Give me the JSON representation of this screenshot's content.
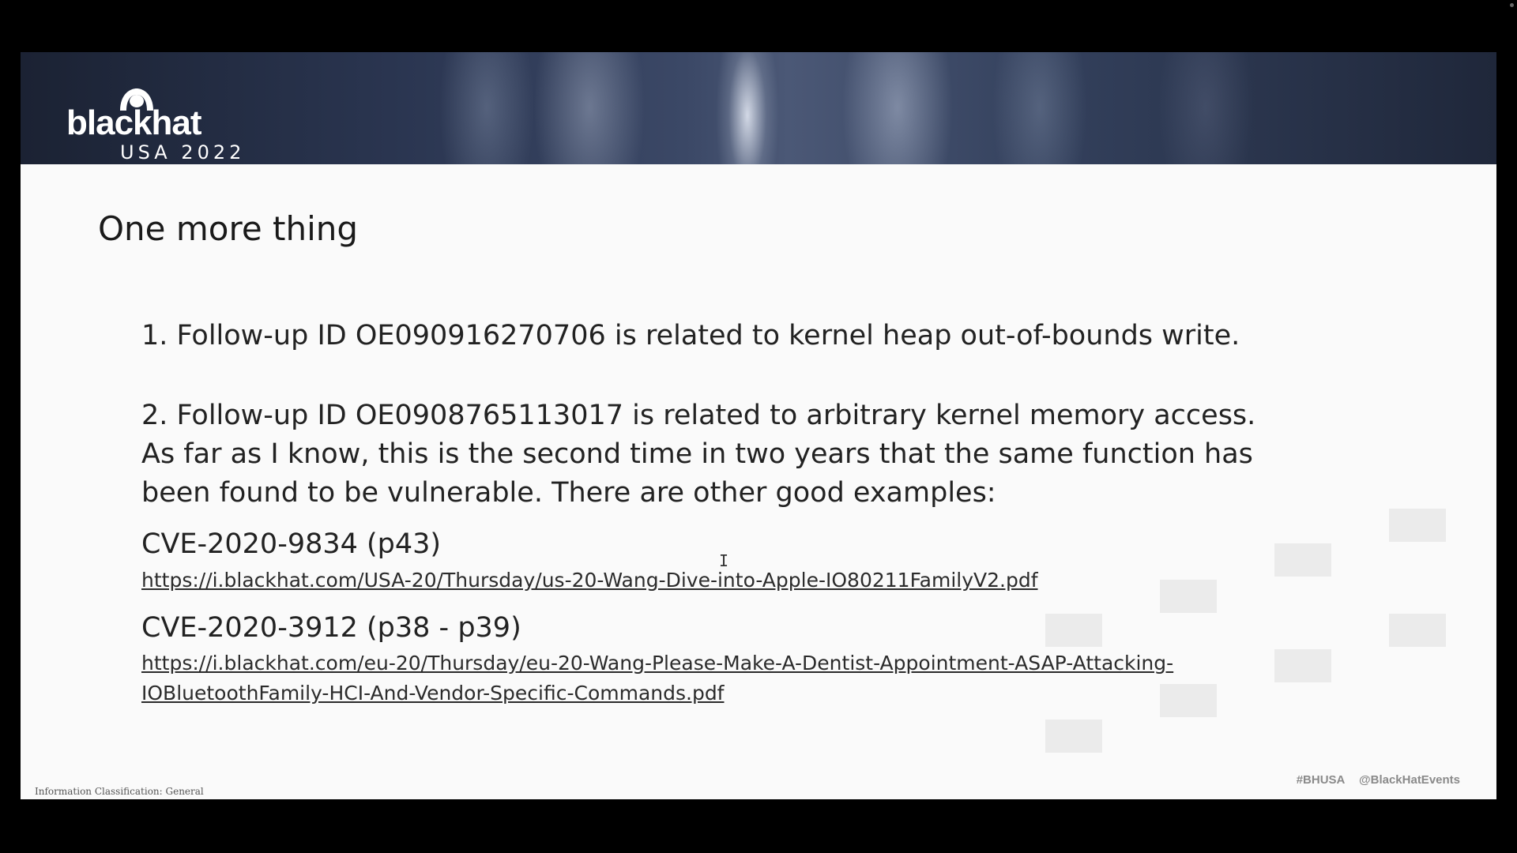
{
  "logo": {
    "brand": "blackhat",
    "sub": "USA 2022"
  },
  "slide": {
    "title": "One more thing",
    "item1": "1. Follow-up ID OE090916270706 is related to kernel heap out-of-bounds write.",
    "item2_lines": [
      "2. Follow-up ID OE0908765113017 is related to arbitrary kernel memory access.",
      "As far as I know, this is the second time in two years that the same function has",
      "been found to be vulnerable. There are other good examples:"
    ],
    "cves": [
      {
        "title": "CVE-2020-9834 (p43)",
        "link_lines": [
          "https://i.blackhat.com/USA-20/Thursday/us-20-Wang-Dive-into-Apple-IO80211FamilyV2.pdf"
        ]
      },
      {
        "title": "CVE-2020-3912 (p38 - p39)",
        "link_lines": [
          "https://i.blackhat.com/eu-20/Thursday/eu-20-Wang-Please-Make-A-Dentist-Appointment-ASAP-Attacking-",
          "IOBluetoothFamily-HCI-And-Vendor-Specific-Commands.pdf"
        ]
      }
    ],
    "footer": {
      "hashtag": "#BHUSA",
      "handle": "@BlackHatEvents",
      "classification": "Information Classification: General"
    }
  },
  "colors": {
    "background": "#000000",
    "slide": "#fafafa",
    "text": "#222222",
    "banner": "#2a3550"
  }
}
